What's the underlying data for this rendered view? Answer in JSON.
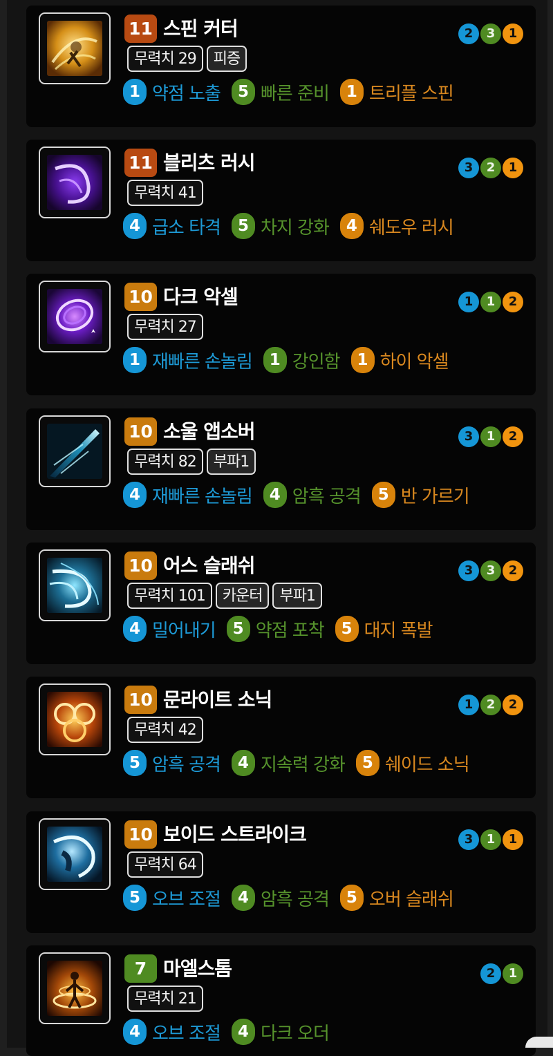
{
  "colors": {
    "blue": "#1596d6",
    "green": "#4f8b22",
    "orange": "#d8830b",
    "red_orange": "#b84a12",
    "card_bg": "#050505",
    "page_bg": "#141414"
  },
  "skills": [
    {
      "name": "스핀 커터",
      "level": "11",
      "level_color": "#b84a12",
      "icon": "spin-cutter-icon",
      "tags": [
        "무력치 29",
        "피증"
      ],
      "dots": [
        "2",
        "3",
        "1"
      ],
      "tripods": [
        {
          "level": "1",
          "name": "약점 노출"
        },
        {
          "level": "5",
          "name": "빠른 준비"
        },
        {
          "level": "1",
          "name": "트리플 스핀"
        }
      ]
    },
    {
      "name": "블리츠 러시",
      "level": "11",
      "level_color": "#b84a12",
      "icon": "blitz-rush-icon",
      "tags": [
        "무력치 41"
      ],
      "dots": [
        "3",
        "2",
        "1"
      ],
      "tripods": [
        {
          "level": "4",
          "name": "급소 타격"
        },
        {
          "level": "5",
          "name": "차지 강화"
        },
        {
          "level": "4",
          "name": "쉐도우 러시"
        }
      ]
    },
    {
      "name": "다크 악셀",
      "level": "10",
      "level_color": "#c97b0e",
      "icon": "dark-axel-icon",
      "tags": [
        "무력치 27"
      ],
      "dots": [
        "1",
        "1",
        "2"
      ],
      "tripods": [
        {
          "level": "1",
          "name": "재빠른 손놀림"
        },
        {
          "level": "1",
          "name": "강인함"
        },
        {
          "level": "1",
          "name": "하이 악셀"
        }
      ]
    },
    {
      "name": "소울 앱소버",
      "level": "10",
      "level_color": "#c97b0e",
      "icon": "soul-absorber-icon",
      "tags": [
        "무력치 82",
        "부파1"
      ],
      "dots": [
        "3",
        "1",
        "2"
      ],
      "tripods": [
        {
          "level": "4",
          "name": "재빠른 손놀림"
        },
        {
          "level": "4",
          "name": "암흑 공격"
        },
        {
          "level": "5",
          "name": "반 가르기"
        }
      ]
    },
    {
      "name": "어스 슬래쉬",
      "level": "10",
      "level_color": "#c97b0e",
      "icon": "earth-slash-icon",
      "tags": [
        "무력치 101",
        "카운터",
        "부파1"
      ],
      "dots": [
        "3",
        "3",
        "2"
      ],
      "tripods": [
        {
          "level": "4",
          "name": "밀어내기"
        },
        {
          "level": "5",
          "name": "약점 포착"
        },
        {
          "level": "5",
          "name": "대지 폭발"
        }
      ]
    },
    {
      "name": "문라이트 소닉",
      "level": "10",
      "level_color": "#c97b0e",
      "icon": "moonlight-sonic-icon",
      "tags": [
        "무력치 42"
      ],
      "dots": [
        "1",
        "2",
        "2"
      ],
      "tripods": [
        {
          "level": "5",
          "name": "암흑 공격"
        },
        {
          "level": "4",
          "name": "지속력 강화"
        },
        {
          "level": "5",
          "name": "쉐이드 소닉"
        }
      ]
    },
    {
      "name": "보이드 스트라이크",
      "level": "10",
      "level_color": "#c97b0e",
      "icon": "void-strike-icon",
      "tags": [
        "무력치 64"
      ],
      "dots": [
        "3",
        "1",
        "1"
      ],
      "tripods": [
        {
          "level": "5",
          "name": "오브 조절"
        },
        {
          "level": "4",
          "name": "암흑 공격"
        },
        {
          "level": "5",
          "name": "오버 슬래쉬"
        }
      ]
    },
    {
      "name": "마엘스톰",
      "level": "7",
      "level_color": "#4f8b22",
      "icon": "maelstrom-icon",
      "tags": [
        "무력치 21"
      ],
      "dots": [
        "2",
        "1"
      ],
      "tripods": [
        {
          "level": "4",
          "name": "오브 조절"
        },
        {
          "level": "4",
          "name": "다크 오더"
        }
      ]
    }
  ]
}
